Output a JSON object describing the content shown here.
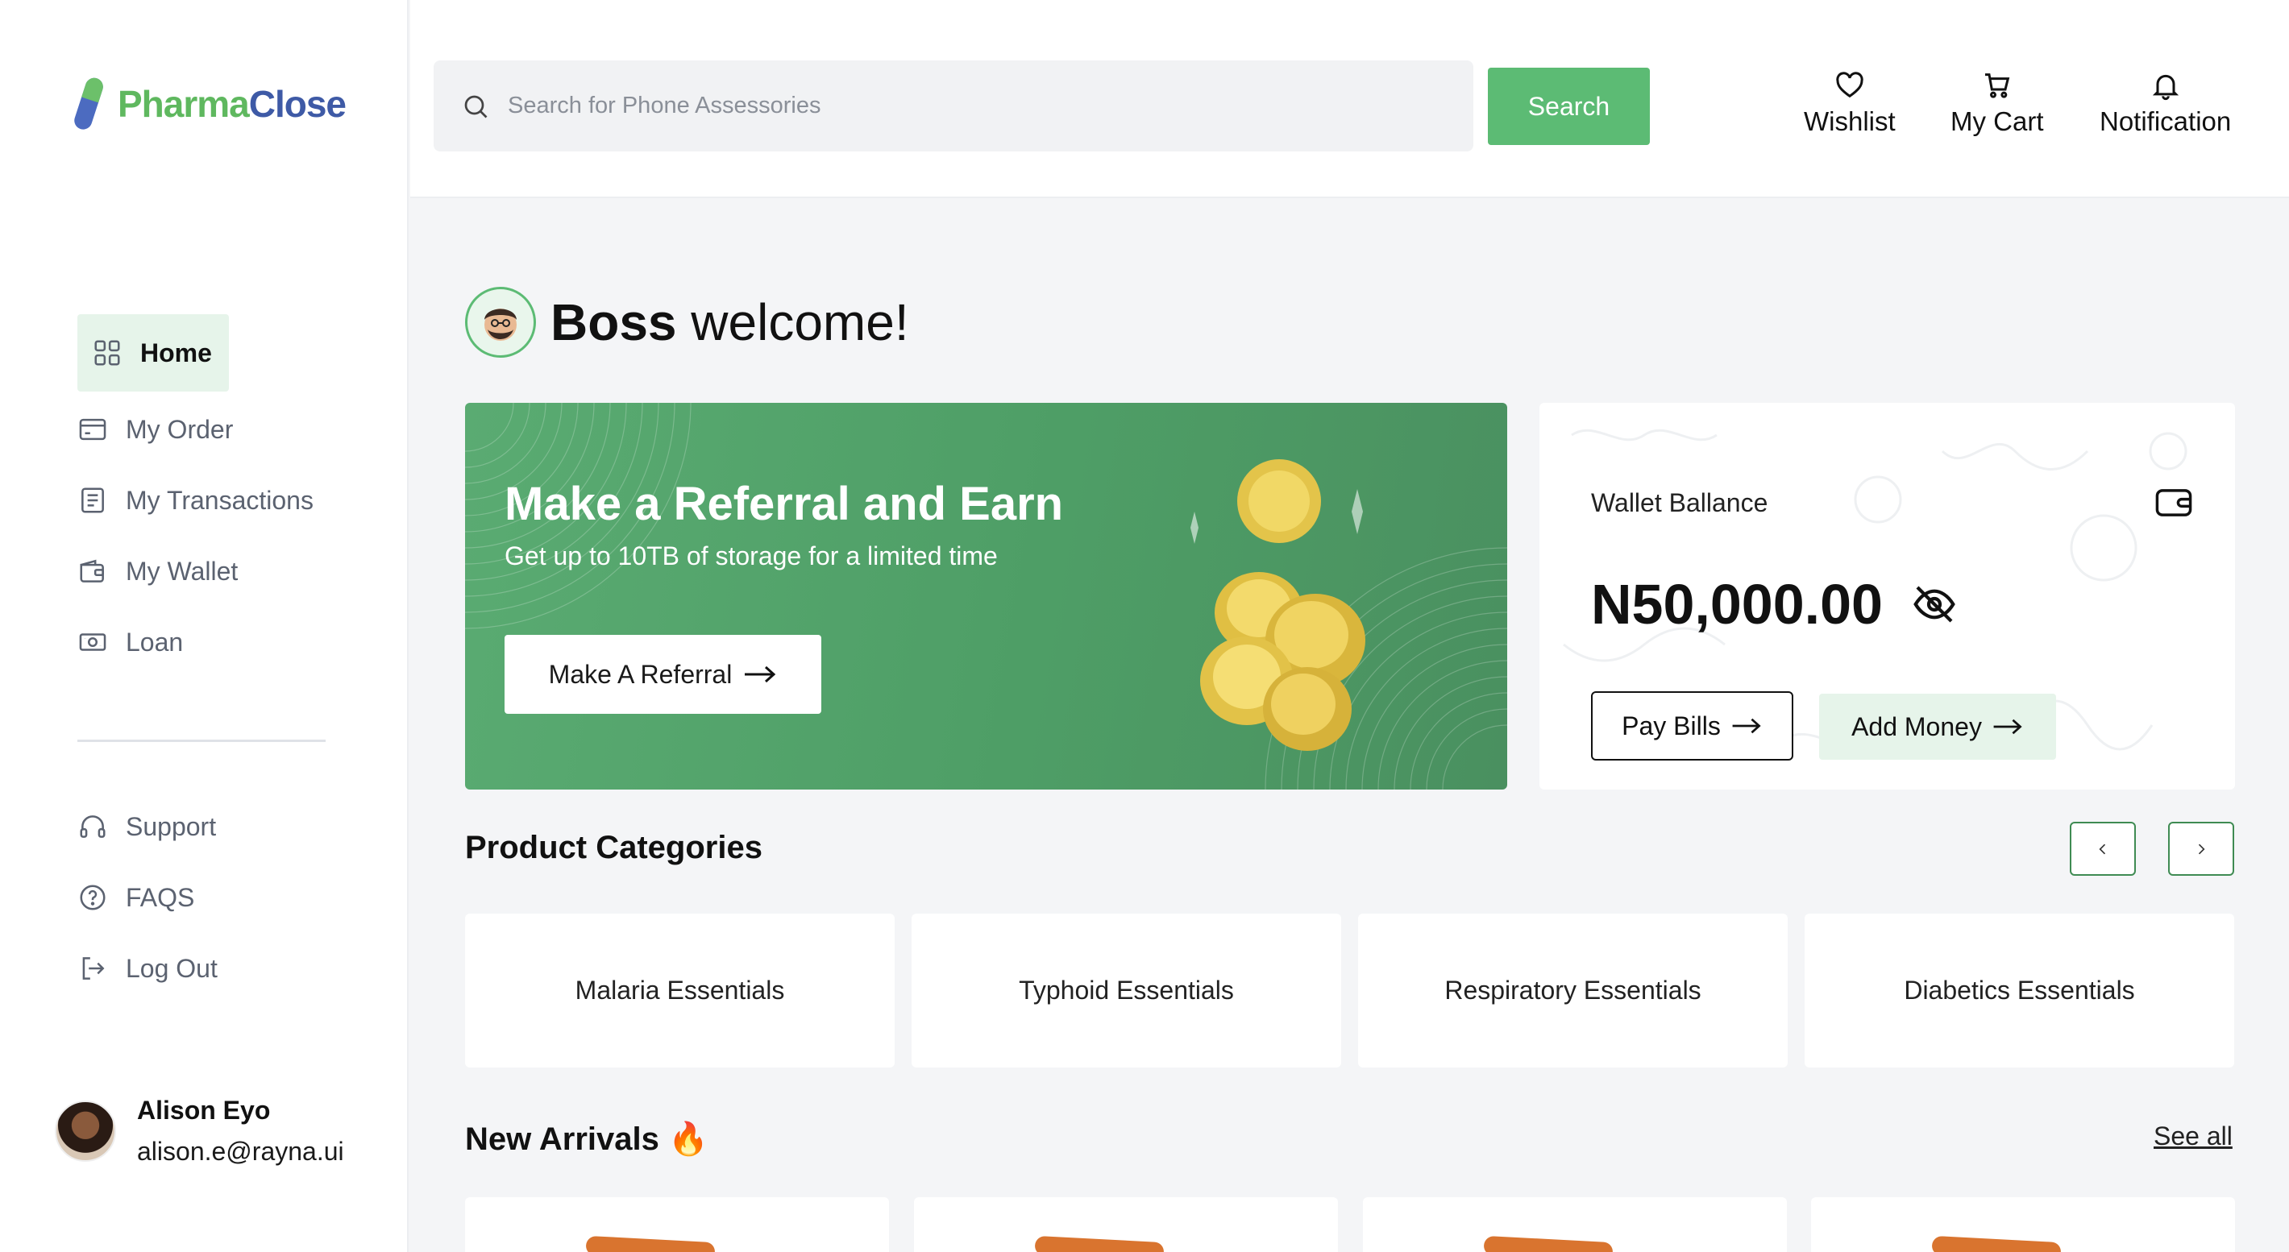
{
  "brand": {
    "logo_part1": "Pharma",
    "logo_part2": "Close",
    "green": "#5fb85f",
    "blue": "#3e5aa6"
  },
  "colors": {
    "accent": "#5cbb74",
    "active_bg": "#e6f4ea",
    "banner": "#4e9e66"
  },
  "sidebar": {
    "items": [
      {
        "label": "Home",
        "icon": "grid-icon",
        "active": true
      },
      {
        "label": "My Order",
        "icon": "card-icon"
      },
      {
        "label": "My Transactions",
        "icon": "receipt-icon"
      },
      {
        "label": "My Wallet",
        "icon": "wallet-icon"
      },
      {
        "label": "Loan",
        "icon": "cash-icon"
      }
    ],
    "secondary": [
      {
        "label": "Support",
        "icon": "headset-icon"
      },
      {
        "label": "FAQS",
        "icon": "question-icon"
      },
      {
        "label": "Log Out",
        "icon": "logout-icon"
      }
    ],
    "user": {
      "name": "Alison Eyo",
      "email": "alison.e@rayna.ui"
    }
  },
  "header": {
    "search_placeholder": "Search for Phone Assessories",
    "search_button": "Search",
    "actions": [
      {
        "label": "Wishlist",
        "icon": "heart-icon"
      },
      {
        "label": "My Cart",
        "icon": "cart-icon"
      },
      {
        "label": "Notification",
        "icon": "bell-icon"
      }
    ]
  },
  "welcome": {
    "name": "Boss",
    "text": "welcome!"
  },
  "referral": {
    "title": "Make a Referral and Earn",
    "subtitle": "Get up to 10TB of storage for a limited time",
    "button": "Make A Referral"
  },
  "wallet": {
    "label": "Wallet Ballance",
    "amount": "N50,000.00",
    "pay_button": "Pay Bills",
    "add_button": "Add Money"
  },
  "categories": {
    "title": "Product Categories",
    "items": [
      "Malaria Essentials",
      "Typhoid Essentials",
      "Respiratory Essentials",
      "Diabetics Essentials"
    ]
  },
  "arrivals": {
    "title": "New Arrivals",
    "emoji": "🔥",
    "see_all": "See all"
  }
}
